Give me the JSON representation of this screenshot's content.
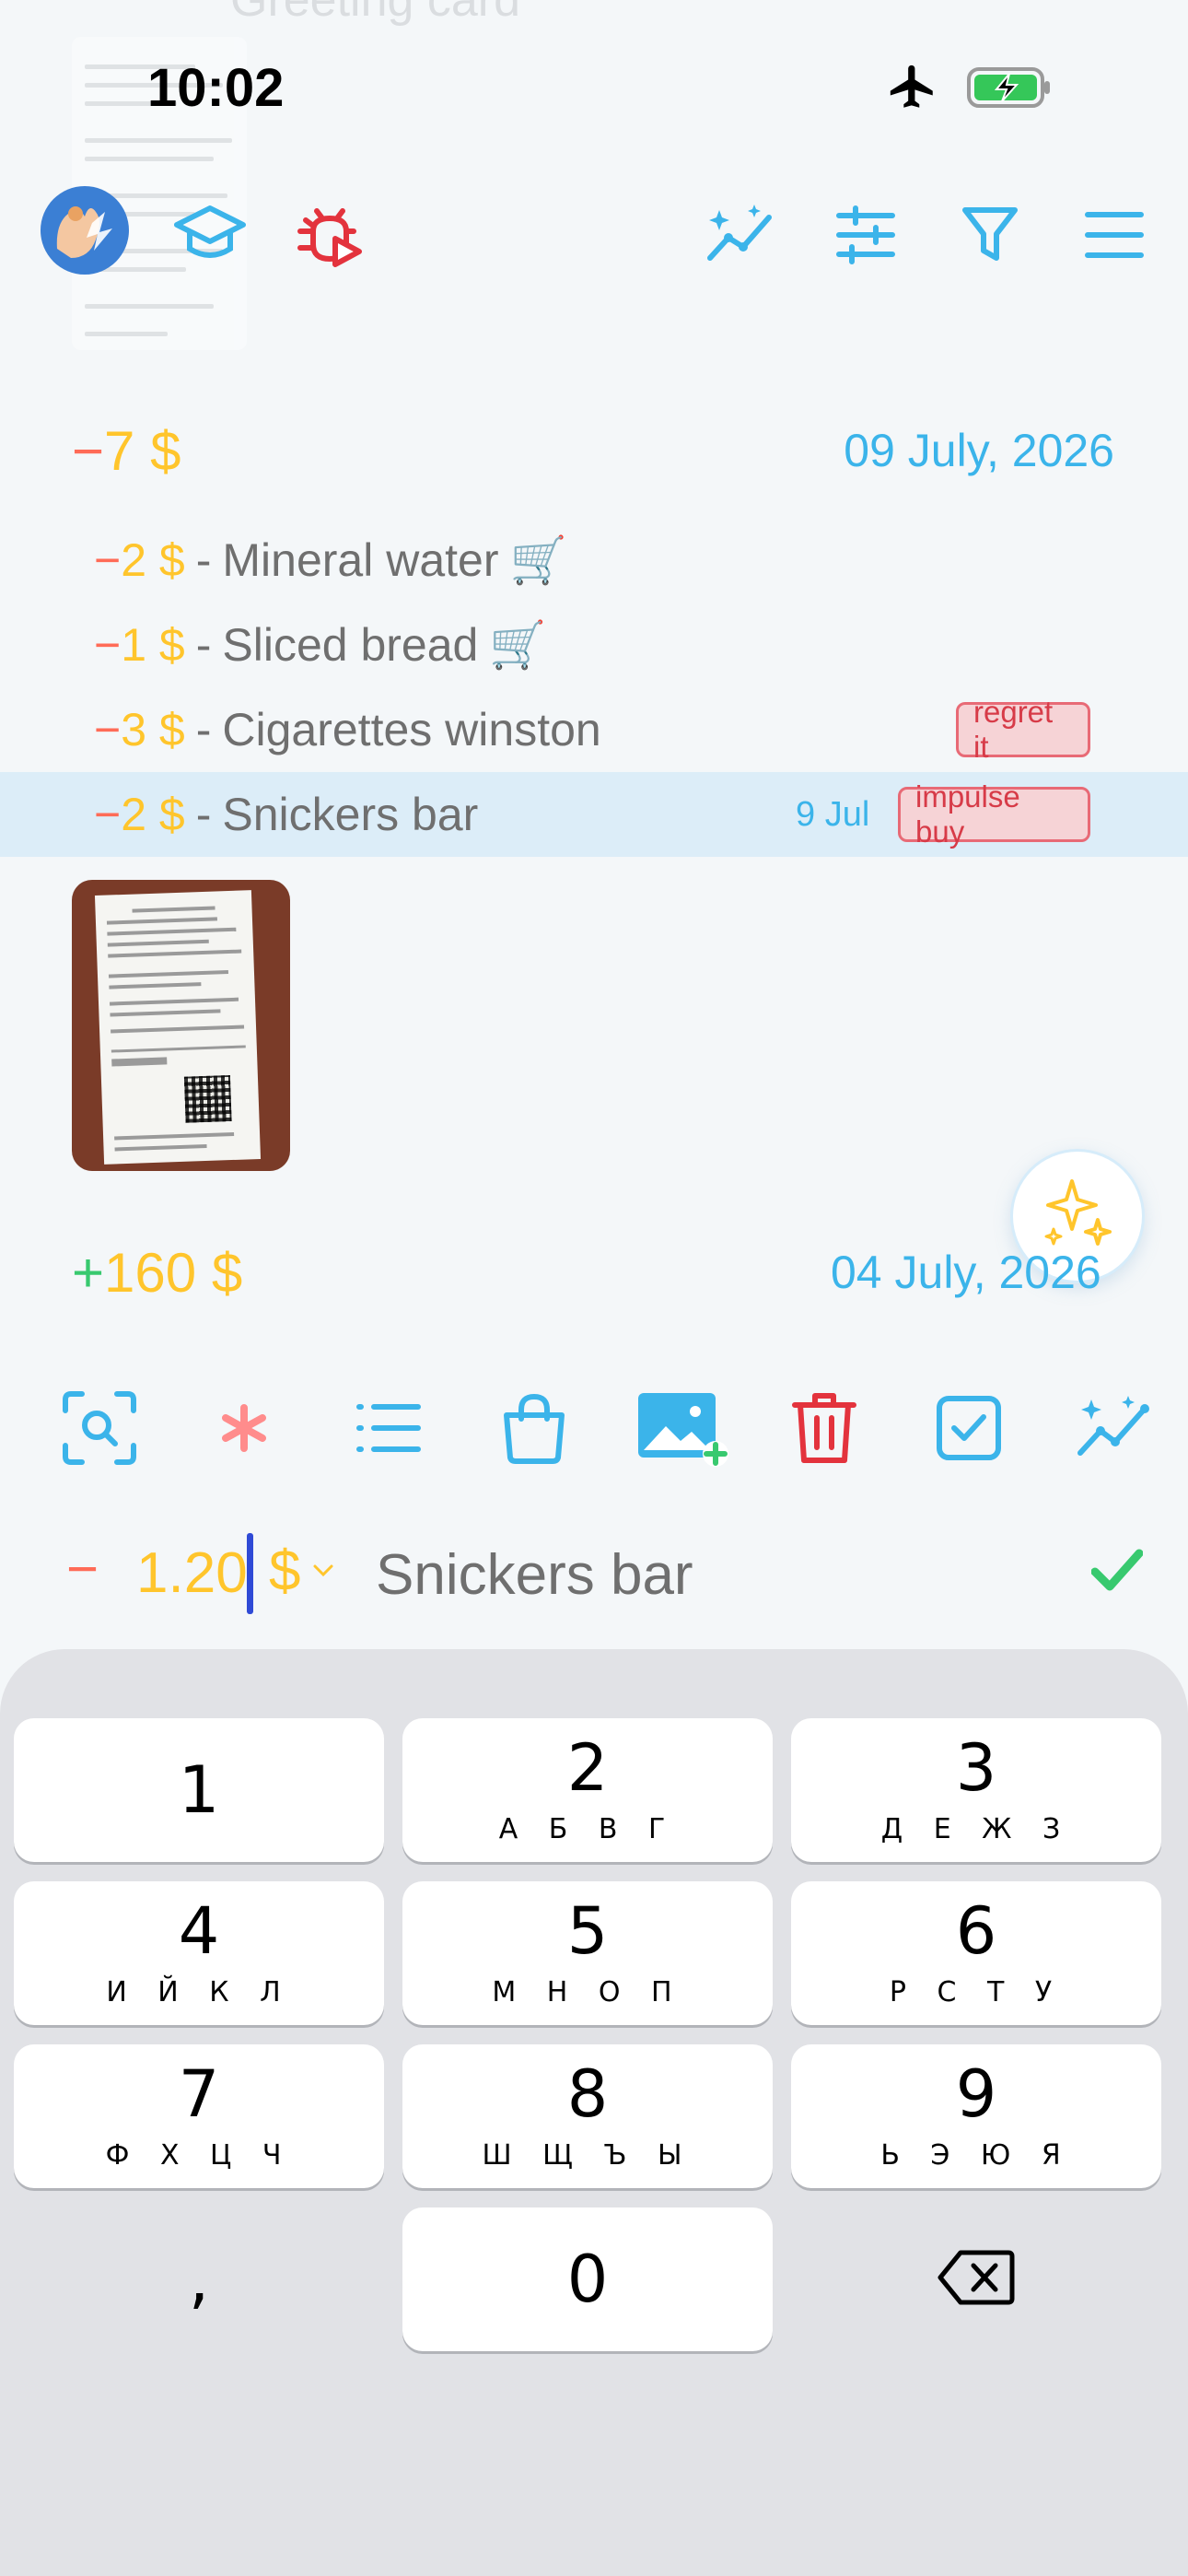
{
  "status_bar": {
    "time": "10:02",
    "airplane_icon": "airplane-icon",
    "battery_icon": "battery-charging-icon"
  },
  "background_partial_text": "Greeting card",
  "toolbar": {
    "left_icons": [
      "avatar-hand-icon",
      "graduation-cap-icon",
      "bug-play-icon"
    ],
    "right_icons": [
      "sparkle-chart-icon",
      "sliders-icon",
      "filter-icon",
      "menu-icon"
    ]
  },
  "day_groups": [
    {
      "sign": "−",
      "amount": "7",
      "currency": "$",
      "date": "09 July, 2026",
      "items": [
        {
          "sign": "−",
          "amount": "2",
          "currency": "$",
          "sep": "-",
          "name": "Mineral water",
          "emoji": "🛒",
          "tag": "",
          "date": ""
        },
        {
          "sign": "−",
          "amount": "1",
          "currency": "$",
          "sep": "-",
          "name": "Sliced bread",
          "emoji": "🛒",
          "tag": "",
          "date": ""
        },
        {
          "sign": "−",
          "amount": "3",
          "currency": "$",
          "sep": "-",
          "name": "Cigarettes winston",
          "emoji": "",
          "tag": "regret it",
          "date": ""
        },
        {
          "sign": "−",
          "amount": "2",
          "currency": "$",
          "sep": "-",
          "name": "Snickers bar",
          "emoji": "",
          "tag": "impulse buy",
          "date": "9 Jul",
          "selected": true
        }
      ]
    },
    {
      "sign": "+",
      "amount": "160",
      "currency": "$",
      "date": "04 July, 2026"
    }
  ],
  "action_bar": {
    "icons": [
      "search-scan-icon",
      "asterisk-icon",
      "list-icon",
      "shopping-bag-icon",
      "add-image-icon",
      "trash-icon",
      "checkbox-icon",
      "sparkle-chart-icon"
    ]
  },
  "input_row": {
    "sign": "−",
    "amount": "1.20",
    "currency": "$",
    "name": "Snickers bar"
  },
  "keyboard": {
    "keys": [
      {
        "num": "1",
        "letters": ""
      },
      {
        "num": "2",
        "letters": "А Б В Г"
      },
      {
        "num": "3",
        "letters": "Д Е Ж З"
      },
      {
        "num": "4",
        "letters": "И Й К Л"
      },
      {
        "num": "5",
        "letters": "М Н О П"
      },
      {
        "num": "6",
        "letters": "Р С Т У"
      },
      {
        "num": "7",
        "letters": "Ф Х Ц Ч"
      },
      {
        "num": "8",
        "letters": "Ш Щ Ъ Ы"
      },
      {
        "num": "9",
        "letters": "Ь Э Ю Я"
      },
      {
        "num": "0",
        "letters": ""
      }
    ],
    "comma": ",",
    "delete_icon": "backspace-icon"
  },
  "colors": {
    "minus": "#ff6b57",
    "plus": "#38c96f",
    "money": "#ffc52c",
    "accent_blue": "#3bb4ea",
    "tag_red": "#d73b48",
    "selected_row": "#dcedf8"
  }
}
